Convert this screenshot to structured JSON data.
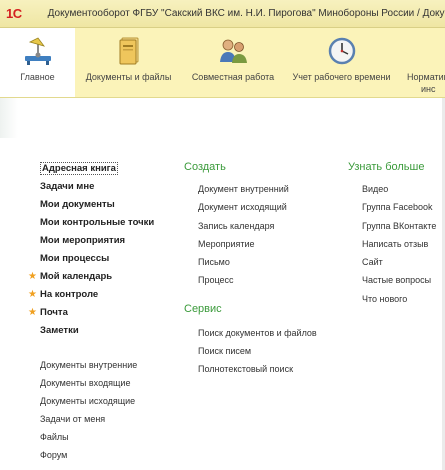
{
  "titlebar": {
    "logo": "1С",
    "title": "Документооборот ФГБУ \"Сакский ВКС им. Н.И. Пирогова\" Минобороны России / Докуме"
  },
  "sections": [
    {
      "label": "Главное",
      "icon": "home-desk-icon"
    },
    {
      "label": "Документы и файлы",
      "icon": "documents-binder-icon"
    },
    {
      "label": "Совместная работа",
      "icon": "people-collaboration-icon"
    },
    {
      "label": "Учет рабочего времени",
      "icon": "clock-icon"
    },
    {
      "label": "Норматив",
      "label2": "инс",
      "icon": "reference-icon"
    }
  ],
  "main_nav": [
    {
      "label": "Адресная книга",
      "starred": false,
      "selected": true
    },
    {
      "label": "Задачи мне",
      "starred": false
    },
    {
      "label": "Мои документы",
      "starred": false
    },
    {
      "label": "Мои контрольные точки",
      "starred": false
    },
    {
      "label": "Мои мероприятия",
      "starred": false
    },
    {
      "label": "Мои процессы",
      "starred": false
    },
    {
      "label": "Мой календарь",
      "starred": true
    },
    {
      "label": "На контроле",
      "starred": true
    },
    {
      "label": "Почта",
      "starred": true
    },
    {
      "label": "Заметки",
      "starred": false
    }
  ],
  "secondary_nav": [
    "Документы внутренние",
    "Документы входящие",
    "Документы исходящие",
    "Задачи от меня",
    "Файлы",
    "Форум"
  ],
  "create": {
    "title": "Создать",
    "items": [
      "Документ внутренний",
      "Документ исходящий",
      "Запись календаря",
      "Мероприятие",
      "Письмо",
      "Процесс"
    ]
  },
  "service": {
    "title": "Сервис",
    "items": [
      "Поиск документов и файлов",
      "Поиск писем",
      "Полнотекстовый поиск"
    ]
  },
  "learn_more": {
    "title": "Узнать больше",
    "items": [
      "Видео",
      "Группа Facebook",
      "Группа ВКонтакте",
      "Написать отзыв",
      "Сайт",
      "Частые вопросы",
      "Что нового"
    ]
  },
  "colors": {
    "titlebar_bg": "#f2eab0",
    "sections_bg": "#fbf3b9",
    "group_title": "#3a9a3a",
    "star": "#f0a020",
    "logo": "#d42020"
  }
}
